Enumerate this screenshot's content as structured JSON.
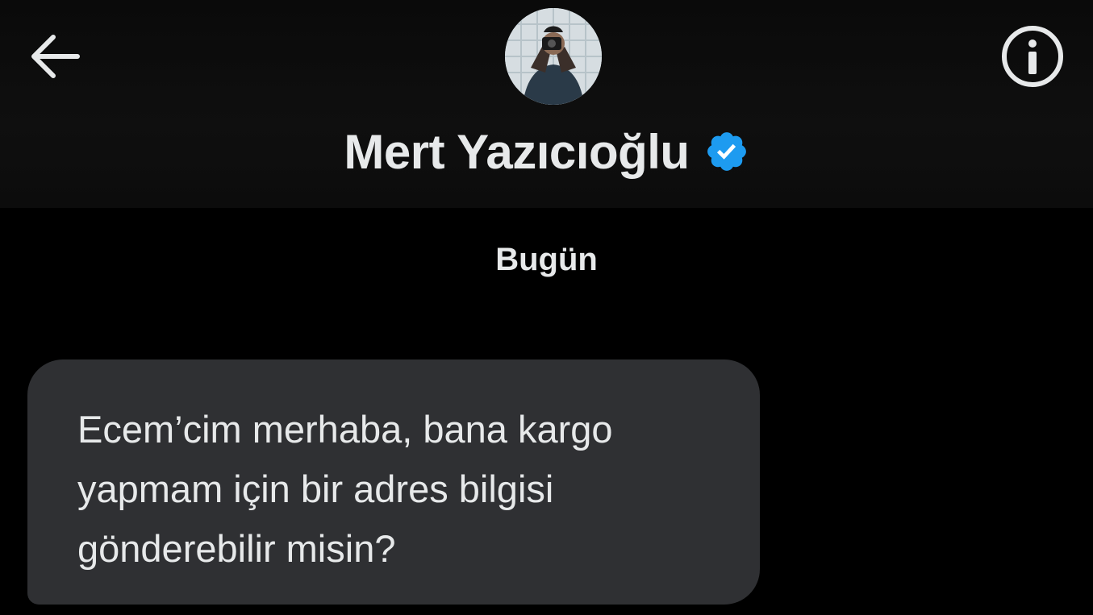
{
  "header": {
    "back_icon": "arrow-left-icon",
    "info_icon": "info-circle-icon",
    "contact_name": "Mert Yazıcıoğlu",
    "verified_icon": "verified-badge-icon",
    "verified_color": "#1d9bf0"
  },
  "conversation": {
    "date_separator": "Bugün",
    "messages": [
      {
        "text": "Ecem’cim merhaba, bana kargo\nyapmam için bir adres bilgisi\ngönderebilir misin?"
      }
    ]
  },
  "colors": {
    "background": "#000000",
    "header_background": "#0d0d0d",
    "bubble_background": "#2f3033",
    "text": "#e7e9ea"
  }
}
